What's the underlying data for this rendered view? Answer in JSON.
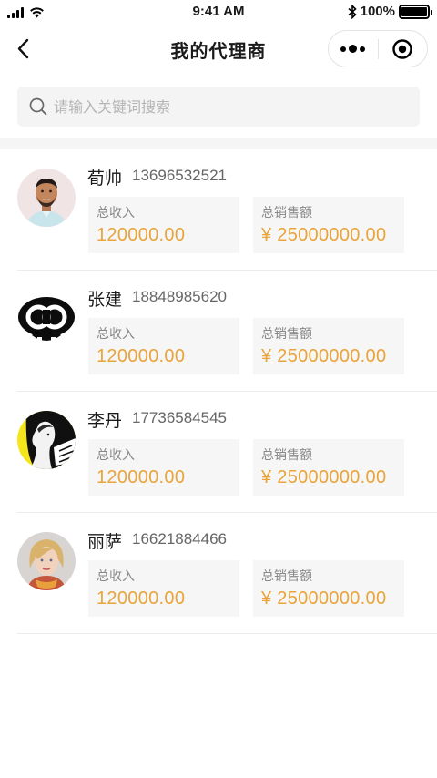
{
  "status_bar": {
    "time": "9:41 AM",
    "battery": "100%"
  },
  "nav": {
    "title": "我的代理商"
  },
  "search": {
    "placeholder": "请输入关键词搜索",
    "value": ""
  },
  "agents": [
    {
      "name": "荀帅",
      "phone": "13696532521",
      "income_label": "总收入",
      "income": "120000.00",
      "sales_label": "总销售额",
      "sales": "¥ 25000000.00",
      "avatar": "man-smiling-avatar"
    },
    {
      "name": "张建",
      "phone": "18848985620",
      "income_label": "总收入",
      "income": "120000.00",
      "sales_label": "总销售额",
      "sales": "¥ 25000000.00",
      "avatar": "black-logo-avatar"
    },
    {
      "name": "李丹",
      "phone": "17736584545",
      "income_label": "总收入",
      "income": "120000.00",
      "sales_label": "总销售额",
      "sales": "¥ 25000000.00",
      "avatar": "fashion-woman-profile-avatar"
    },
    {
      "name": "丽萨",
      "phone": "16621884466",
      "income_label": "总收入",
      "income": "120000.00",
      "sales_label": "总销售额",
      "sales": "¥ 25000000.00",
      "avatar": "blonde-woman-avatar"
    }
  ],
  "colors": {
    "accent": "#e9a43b",
    "stat_bg": "#f6f6f6",
    "search_bg": "#f4f4f4"
  }
}
